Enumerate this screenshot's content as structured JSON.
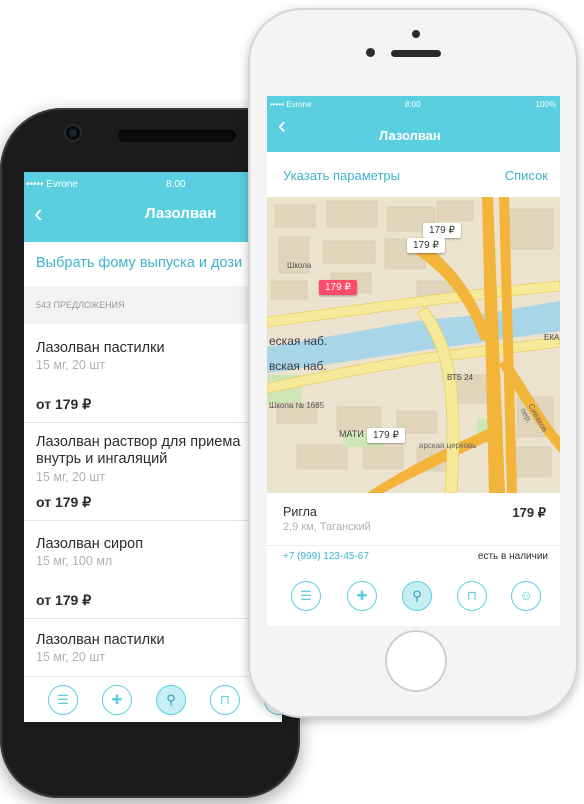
{
  "android": {
    "status": {
      "carrier": "••••• Evrone",
      "time": "8:00"
    },
    "header": {
      "back_icon": "‹",
      "title": "Лазолван"
    },
    "filter_label": "Выбрать фому выпуска и дози",
    "offers_count": "543 ПРЕДЛОЖЕНИЯ",
    "items": [
      {
        "name": "Лазолван пастилки",
        "details": "15 мг, 20 шт",
        "price": "от 179 ₽"
      },
      {
        "name": "Лазолван раствор для приема внутрь и ингаляций",
        "name_line1": "Лазолван раствор для приема",
        "name_line2": "внутрь и ингаляций",
        "details": "15 мг, 20 шт",
        "price": "от 179 ₽"
      },
      {
        "name": "Лазолван сироп",
        "details": "15 мг, 100 мл",
        "price": "от 179 ₽"
      },
      {
        "name": "Лазолван пастилки",
        "details": "15 мг, 20 шт",
        "price": ""
      }
    ],
    "tabs": [
      "list-icon",
      "pharmacy-cross-icon",
      "search-icon",
      "bookmark-icon",
      "profile-icon"
    ]
  },
  "iphone": {
    "status": {
      "carrier": "••••• Evrone",
      "time": "8:00",
      "battery": "100%"
    },
    "header": {
      "back_icon": "‹",
      "title": "Лазолван"
    },
    "actions": {
      "params": "Указать параметры",
      "list": "Список"
    },
    "map": {
      "street_1": "еская наб.",
      "street_2": "вская наб.",
      "school": "Школа",
      "school_1685": "Школа № 1685",
      "mati": "МАТИ",
      "bank": "ВТБ 24",
      "eka": "ЕКА",
      "church": "ирская церковь",
      "lane": "Сиваков пер.",
      "pins": [
        {
          "label": "179 ₽",
          "selected": true
        },
        {
          "label": "179 ₽",
          "selected": false
        },
        {
          "label": "179 ₽",
          "selected": false
        },
        {
          "label": "179 ₽",
          "selected": false
        }
      ]
    },
    "pharmacy": {
      "name": "Ригла",
      "price": "179 ₽",
      "distance": "2,9 км, Таганский",
      "phone": "+7 (999) 123-45-67",
      "stock": "есть в наличии"
    },
    "tabs": [
      "list-icon",
      "pharmacy-cross-icon",
      "search-icon",
      "bookmark-icon",
      "profile-icon"
    ]
  },
  "colors": {
    "accent": "#59cfe0",
    "link": "#3fb2cf",
    "pin_selected": "#ff4b6a",
    "road": "#f3b43a"
  }
}
